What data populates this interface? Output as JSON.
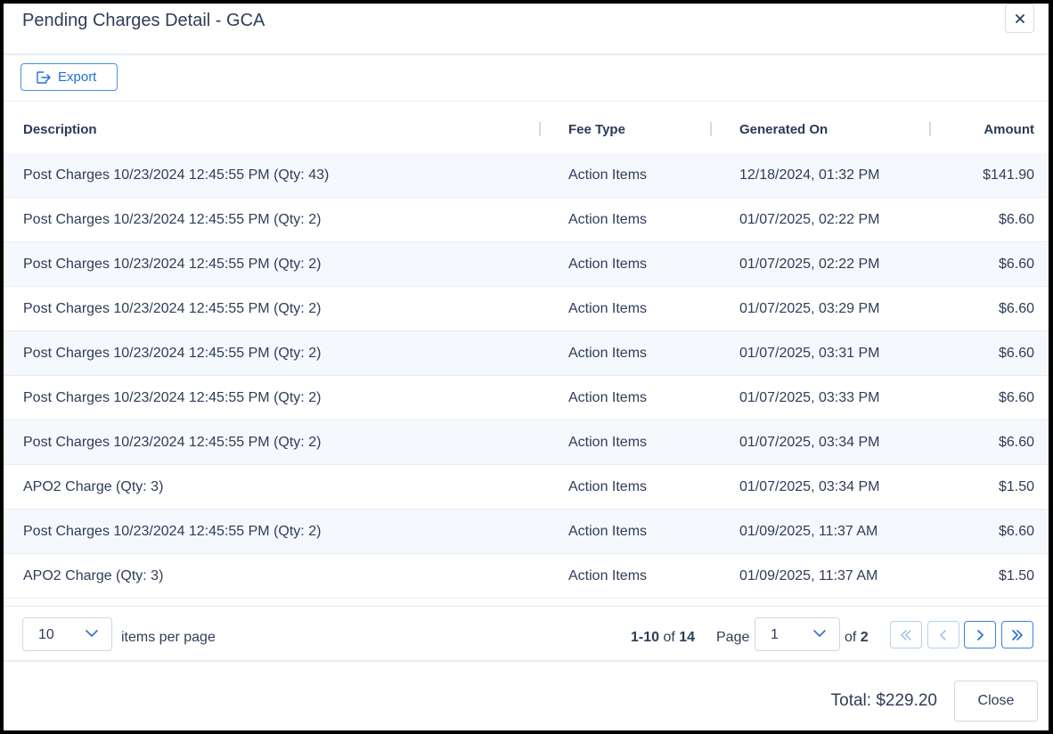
{
  "dialog": {
    "title": "Pending Charges Detail - GCA"
  },
  "toolbar": {
    "export_label": "Export"
  },
  "table": {
    "columns": [
      "Description",
      "Fee Type",
      "Generated On",
      "Amount"
    ],
    "rows": [
      [
        "Post Charges 10/23/2024 12:45:55 PM (Qty: 43)",
        "Action Items",
        "12/18/2024, 01:32 PM",
        "$141.90"
      ],
      [
        "Post Charges 10/23/2024 12:45:55 PM (Qty: 2)",
        "Action Items",
        "01/07/2025, 02:22 PM",
        "$6.60"
      ],
      [
        "Post Charges 10/23/2024 12:45:55 PM (Qty: 2)",
        "Action Items",
        "01/07/2025, 02:22 PM",
        "$6.60"
      ],
      [
        "Post Charges 10/23/2024 12:45:55 PM (Qty: 2)",
        "Action Items",
        "01/07/2025, 03:29 PM",
        "$6.60"
      ],
      [
        "Post Charges 10/23/2024 12:45:55 PM (Qty: 2)",
        "Action Items",
        "01/07/2025, 03:31 PM",
        "$6.60"
      ],
      [
        "Post Charges 10/23/2024 12:45:55 PM (Qty: 2)",
        "Action Items",
        "01/07/2025, 03:33 PM",
        "$6.60"
      ],
      [
        "Post Charges 10/23/2024 12:45:55 PM (Qty: 2)",
        "Action Items",
        "01/07/2025, 03:34 PM",
        "$6.60"
      ],
      [
        "APO2 Charge (Qty: 3)",
        "Action Items",
        "01/07/2025, 03:34 PM",
        "$1.50"
      ],
      [
        "Post Charges 10/23/2024 12:45:55 PM (Qty: 2)",
        "Action Items",
        "01/09/2025, 11:37 AM",
        "$6.60"
      ],
      [
        "APO2 Charge (Qty: 3)",
        "Action Items",
        "01/09/2025, 11:37 AM",
        "$1.50"
      ]
    ]
  },
  "pagination": {
    "page_size": "10",
    "items_per_page_label": "items per page",
    "range": "1-10",
    "of_label": "of",
    "total_items": "14",
    "page_label": "Page",
    "current_page": "1",
    "total_pages": "2"
  },
  "footer": {
    "total_text": "Total: $229.20",
    "close_label": "Close"
  },
  "colors": {
    "accent": "#1f6fd6",
    "row_alt": "#f5f8fc",
    "text": "#2f3d57"
  },
  "icons": {
    "close": "close-icon",
    "export": "export-icon",
    "chevron": "chevron-down-icon",
    "first": "first-page-icon",
    "prev": "prev-page-icon",
    "next": "next-page-icon",
    "last": "last-page-icon"
  }
}
